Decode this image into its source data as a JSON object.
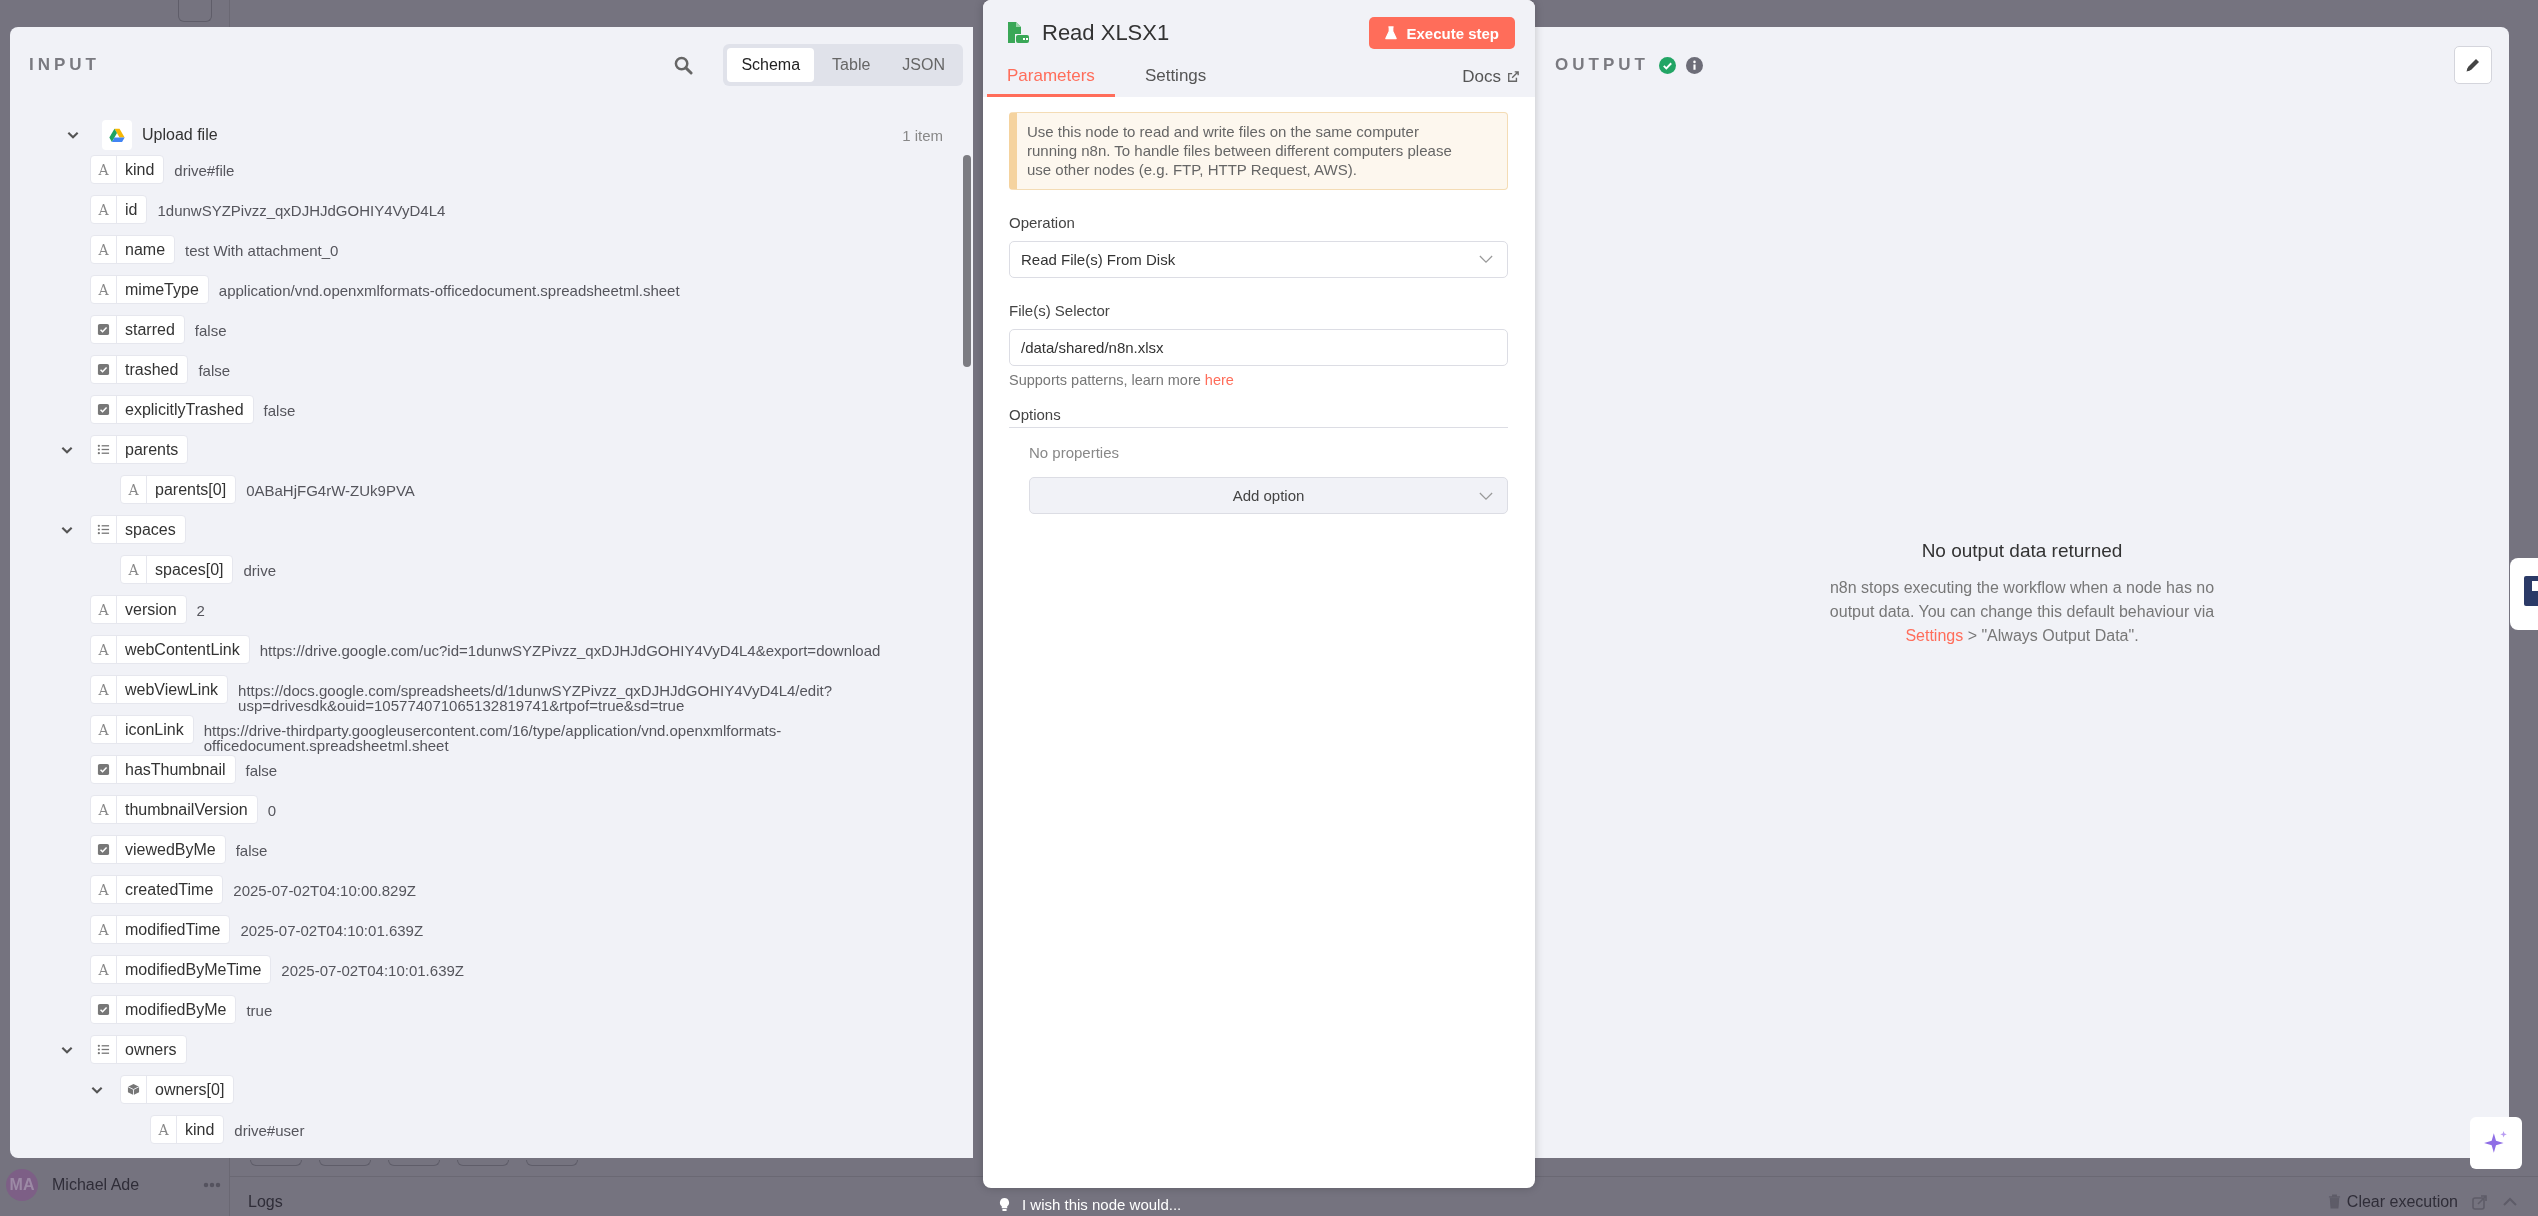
{
  "background": {
    "user": {
      "initials": "MA",
      "name": "Michael Ade"
    },
    "logs_label": "Logs",
    "clear_label": "Clear execution"
  },
  "input": {
    "title": "INPUT",
    "view_modes": [
      {
        "label": "Schema",
        "selected": true
      },
      {
        "label": "Table",
        "selected": false
      },
      {
        "label": "JSON",
        "selected": false
      }
    ],
    "tree": {
      "label": "Upload file",
      "count": "1 item",
      "expanded": true,
      "children": [
        {
          "kind": "string",
          "icon": "A",
          "key": "kind",
          "value": "drive#file"
        },
        {
          "kind": "string",
          "icon": "A",
          "key": "id",
          "value": "1dunwSYZPivzz_qxDJHJdGOHIY4VyD4L4"
        },
        {
          "kind": "string",
          "icon": "A",
          "key": "name",
          "value": "test With attachment_0"
        },
        {
          "kind": "string",
          "icon": "A",
          "key": "mimeType",
          "value": "application/vnd.openxmlformats-officedocument.spreadsheetml.sheet"
        },
        {
          "kind": "boolean",
          "key": "starred",
          "value": "false"
        },
        {
          "kind": "boolean",
          "key": "trashed",
          "value": "false"
        },
        {
          "kind": "boolean",
          "key": "explicitlyTrashed",
          "value": "false"
        },
        {
          "kind": "array",
          "key": "parents",
          "expanded": true,
          "children": [
            {
              "kind": "string",
              "icon": "A",
              "key": "parents[0]",
              "value": "0ABaHjFG4rW-ZUk9PVA"
            }
          ]
        },
        {
          "kind": "array",
          "key": "spaces",
          "expanded": true,
          "children": [
            {
              "kind": "string",
              "icon": "A",
              "key": "spaces[0]",
              "value": "drive"
            }
          ]
        },
        {
          "kind": "string",
          "icon": "A",
          "key": "version",
          "value": "2"
        },
        {
          "kind": "string",
          "icon": "A",
          "key": "webContentLink",
          "value": "https://drive.google.com/uc?id=1dunwSYZPivzz_qxDJHJdGOHIY4VyD4L4&export=download"
        },
        {
          "kind": "string",
          "icon": "A",
          "key": "webViewLink",
          "value": "https://docs.google.com/spreadsheets/d/1dunwSYZPivzz_qxDJHJdGOHIY4VyD4L4/edit?usp=drivesdk&ouid=105774071065132819741&rtpof=true&sd=true"
        },
        {
          "kind": "string",
          "icon": "A",
          "key": "iconLink",
          "value": "https://drive-thirdparty.googleusercontent.com/16/type/application/vnd.openxmlformats-officedocument.spreadsheetml.sheet"
        },
        {
          "kind": "boolean",
          "key": "hasThumbnail",
          "value": "false"
        },
        {
          "kind": "string",
          "icon": "A",
          "key": "thumbnailVersion",
          "value": "0"
        },
        {
          "kind": "boolean",
          "key": "viewedByMe",
          "value": "false"
        },
        {
          "kind": "string",
          "icon": "A",
          "key": "createdTime",
          "value": "2025-07-02T04:10:00.829Z"
        },
        {
          "kind": "string",
          "icon": "A",
          "key": "modifiedTime",
          "value": "2025-07-02T04:10:01.639Z"
        },
        {
          "kind": "string",
          "icon": "A",
          "key": "modifiedByMeTime",
          "value": "2025-07-02T04:10:01.639Z"
        },
        {
          "kind": "boolean",
          "key": "modifiedByMe",
          "value": "true"
        },
        {
          "kind": "array",
          "key": "owners",
          "expanded": true,
          "children": [
            {
              "kind": "object",
              "key": "owners[0]",
              "expanded": true,
              "children": [
                {
                  "kind": "string",
                  "icon": "A",
                  "key": "kind",
                  "value": "drive#user"
                }
              ]
            }
          ]
        }
      ]
    }
  },
  "node": {
    "title": "Read XLSX1",
    "execute_label": "Execute step",
    "tabs": [
      {
        "label": "Parameters",
        "selected": true
      },
      {
        "label": "Settings",
        "selected": false
      }
    ],
    "docs_label": "Docs",
    "notice": "Use this node to read and write files on the same computer running n8n. To handle files between different computers please use other nodes (e.g. FTP, HTTP Request, AWS).",
    "fields": [
      {
        "kind": "select",
        "label": "Operation",
        "value": "Read File(s) From Disk"
      },
      {
        "kind": "text",
        "label": "File(s) Selector",
        "value": "/data/shared/n8n.xlsx",
        "hint": "Supports patterns, learn more ",
        "hint_link": "here"
      }
    ],
    "options": {
      "label": "Options",
      "empty_text": "No properties",
      "add_label": "Add option"
    },
    "feedback": "I wish this node would..."
  },
  "output": {
    "title": "OUTPUT",
    "empty_title": "No output data returned",
    "empty_text_before": "n8n stops executing the workflow when a node has no output data. You can change this default behaviour via ",
    "empty_link": "Settings",
    "empty_text_after": " > \"Always Output Data\"."
  }
}
